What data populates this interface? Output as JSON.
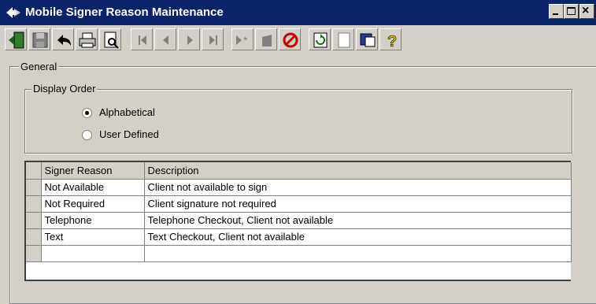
{
  "window": {
    "title": "Mobile Signer Reason Maintenance",
    "min_icon": "minimize-icon",
    "max_icon": "maximize-icon",
    "close_icon": "close-icon",
    "title_bg": "#0a246a"
  },
  "toolbar": {
    "buttons": [
      {
        "name": "exit-button",
        "icon": "exit-door-icon"
      },
      {
        "name": "save-button",
        "icon": "floppy-disk-icon"
      },
      {
        "name": "undo-button",
        "icon": "undo-arrow-icon"
      },
      {
        "name": "print-button",
        "icon": "printer-icon"
      },
      {
        "name": "print-preview-button",
        "icon": "print-preview-icon"
      },
      {
        "name": "first-record-button",
        "icon": "first-record-icon"
      },
      {
        "name": "previous-record-button",
        "icon": "previous-record-icon"
      },
      {
        "name": "next-record-button",
        "icon": "next-record-icon"
      },
      {
        "name": "last-record-button",
        "icon": "last-record-icon"
      },
      {
        "name": "new-record-button",
        "icon": "new-record-icon"
      },
      {
        "name": "delete-record-button",
        "icon": "delete-record-icon"
      },
      {
        "name": "cancel-button",
        "icon": "no-entry-icon"
      },
      {
        "name": "refresh-button",
        "icon": "refresh-icon"
      },
      {
        "name": "notes-button",
        "icon": "blank-page-icon"
      },
      {
        "name": "window-button",
        "icon": "window-icon"
      },
      {
        "name": "help-button",
        "icon": "help-question-icon"
      }
    ]
  },
  "general": {
    "label": "General",
    "display_order": {
      "label": "Display Order",
      "options": [
        {
          "label": "Alphabetical",
          "selected": true
        },
        {
          "label": "User Defined",
          "selected": false
        }
      ]
    }
  },
  "grid": {
    "columns": [
      "Signer Reason",
      "Description"
    ],
    "rows": [
      [
        "Not Available",
        "Client not available to sign"
      ],
      [
        "Not Required",
        "Client signature not required"
      ],
      [
        "Telephone",
        "Telephone Checkout, Client not available"
      ],
      [
        "Text",
        "Text Checkout, Client not available"
      ],
      [
        "",
        ""
      ]
    ]
  }
}
